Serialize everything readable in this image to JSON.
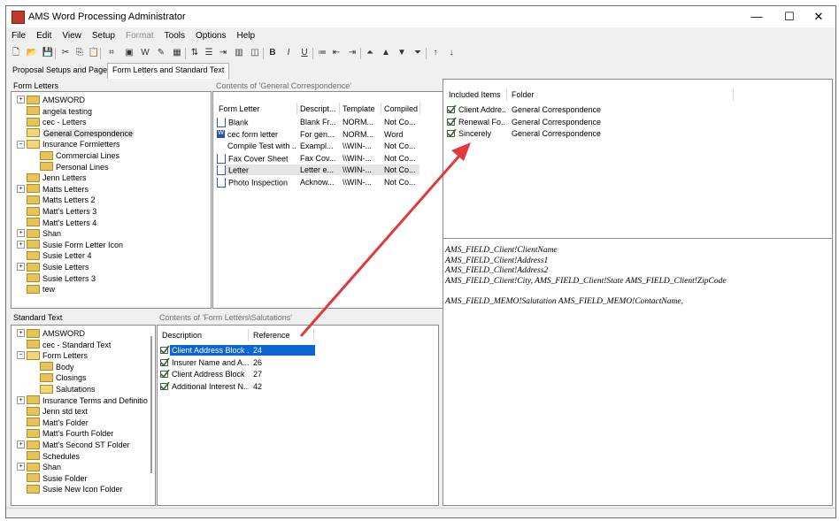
{
  "window": {
    "title": "AMS Word Processing Administrator",
    "controls": {
      "minimize": "—",
      "maximize": "☐",
      "close": "✕"
    }
  },
  "menu": [
    "File",
    "Edit",
    "View",
    "Setup",
    "Format",
    "Tools",
    "Options",
    "Help"
  ],
  "menu_disabled": [
    "Format"
  ],
  "toolbar_icons": [
    "new-icon",
    "open-icon",
    "save-icon",
    "cut-icon",
    "copy-icon",
    "paste-icon",
    "field-icon",
    "pdf-icon",
    "word-icon",
    "edit-icon",
    "preview-icon",
    "sort-icon",
    "list-icon",
    "indent-icon",
    "table-icon",
    "properties-icon",
    "bold-icon",
    "italic-icon",
    "underline-icon",
    "bullets-icon",
    "outdent-icon",
    "indent-more-icon",
    "move-top-icon",
    "move-up-icon",
    "move-down-icon",
    "move-bottom-icon",
    "arrow-up-icon",
    "arrow-down-icon"
  ],
  "toolbar_glyphs": {
    "bold": "B",
    "italic": "I",
    "underline": "U"
  },
  "tabs": [
    {
      "label": "Proposal Setups and Pages",
      "active": false
    },
    {
      "label": "Form Letters and Standard Text",
      "active": true
    }
  ],
  "form_letters": {
    "label": "Form Letters",
    "tree": [
      {
        "label": "AMSWORD",
        "level": 0,
        "expander": "+",
        "open": false,
        "selected": false
      },
      {
        "label": "angela testing",
        "level": 0,
        "expander": "",
        "open": false,
        "selected": false
      },
      {
        "label": "cec - Letters",
        "level": 0,
        "expander": "",
        "open": false,
        "selected": false
      },
      {
        "label": "General Correspondence",
        "level": 0,
        "expander": "",
        "open": true,
        "selected": true
      },
      {
        "label": "Insurance Formletters",
        "level": 0,
        "expander": "−",
        "open": true,
        "selected": false
      },
      {
        "label": "Commercial Lines",
        "level": 1,
        "expander": "",
        "open": false,
        "selected": false
      },
      {
        "label": "Personal Lines",
        "level": 1,
        "expander": "",
        "open": false,
        "selected": false
      },
      {
        "label": "Jenn Letters",
        "level": 0,
        "expander": "",
        "open": false,
        "selected": false
      },
      {
        "label": "Matts Letters",
        "level": 0,
        "expander": "+",
        "open": false,
        "selected": false
      },
      {
        "label": "Matts Letters 2",
        "level": 0,
        "expander": "",
        "open": false,
        "selected": false
      },
      {
        "label": "Matt's Letters 3",
        "level": 0,
        "expander": "",
        "open": false,
        "selected": false
      },
      {
        "label": "Matt's Letters 4",
        "level": 0,
        "expander": "",
        "open": false,
        "selected": false
      },
      {
        "label": "Shan",
        "level": 0,
        "expander": "+",
        "open": false,
        "selected": false
      },
      {
        "label": "Susie Form Letter Icon",
        "level": 0,
        "expander": "+",
        "open": false,
        "selected": false
      },
      {
        "label": "Susie Letter 4",
        "level": 0,
        "expander": "",
        "open": false,
        "selected": false
      },
      {
        "label": "Susie Letters",
        "level": 0,
        "expander": "+",
        "open": false,
        "selected": false
      },
      {
        "label": "Susie Letters 3",
        "level": 0,
        "expander": "",
        "open": false,
        "selected": false
      },
      {
        "label": "tew",
        "level": 0,
        "expander": "",
        "open": false,
        "selected": false
      }
    ]
  },
  "contents_letters": {
    "label": "Contents of 'General Correspondence'",
    "columns": [
      "Form Letter",
      "Descript...",
      "Template",
      "Compiled"
    ],
    "rows": [
      {
        "icon": "doc",
        "cells": [
          "Blank",
          "Blank Fr...",
          "NORM...",
          "Not Co..."
        ],
        "selected": false
      },
      {
        "icon": "word",
        "cells": [
          "cec form letter",
          "For gen...",
          "NORM...",
          "Word"
        ],
        "selected": false
      },
      {
        "icon": "none",
        "cells": [
          "Compile Test with ...",
          "Exampl...",
          "\\\\WIN-...",
          "Not Co..."
        ],
        "selected": false
      },
      {
        "icon": "doc",
        "cells": [
          "Fax Cover Sheet",
          "Fax Cov...",
          "\\\\WIN-...",
          "Not Co..."
        ],
        "selected": false
      },
      {
        "icon": "doc",
        "cells": [
          "Letter",
          "Letter e...",
          "\\\\WIN-...",
          "Not Co..."
        ],
        "selected": true
      },
      {
        "icon": "doc",
        "cells": [
          "Photo Inspection",
          "Acknow...",
          "\\\\WIN-...",
          "Not Co..."
        ],
        "selected": false
      }
    ]
  },
  "included": {
    "columns": [
      "Included Items",
      "Folder"
    ],
    "rows": [
      {
        "item": "Client Addre...",
        "folder": "General Correspondence"
      },
      {
        "item": "Renewal Fo...",
        "folder": "General Correspondence"
      },
      {
        "item": "Sincerely",
        "folder": "General Correspondence"
      }
    ]
  },
  "preview_lines": [
    "AMS_FIELD_Client!ClientName",
    "AMS_FIELD_Client!Address1",
    "AMS_FIELD_Client!Address2",
    "AMS_FIELD_Client!City, AMS_FIELD_Client!State  AMS_FIELD_Client!ZipCode",
    "",
    "AMS_FIELD_MEMO!Salutation AMS_FIELD_MEMO!ContactName,"
  ],
  "standard_text": {
    "label": "Standard Text",
    "tree": [
      {
        "label": "AMSWORD",
        "level": 0,
        "expander": "+",
        "open": false
      },
      {
        "label": "cec - Standard Text",
        "level": 0,
        "expander": "",
        "open": false
      },
      {
        "label": "Form Letters",
        "level": 0,
        "expander": "−",
        "open": true
      },
      {
        "label": "Body",
        "level": 1,
        "expander": "",
        "open": false
      },
      {
        "label": "Closings",
        "level": 1,
        "expander": "",
        "open": false
      },
      {
        "label": "Salutations",
        "level": 1,
        "expander": "",
        "open": true
      },
      {
        "label": "Insurance Terms and Definitio",
        "level": 0,
        "expander": "+",
        "open": false
      },
      {
        "label": "Jenn std text",
        "level": 0,
        "expander": "",
        "open": false
      },
      {
        "label": "Matt's Folder",
        "level": 0,
        "expander": "",
        "open": false
      },
      {
        "label": "Matt's Fourth Folder",
        "level": 0,
        "expander": "",
        "open": false
      },
      {
        "label": "Matt's Second ST Folder",
        "level": 0,
        "expander": "+",
        "open": false
      },
      {
        "label": "Schedules",
        "level": 0,
        "expander": "",
        "open": false
      },
      {
        "label": "Shan",
        "level": 0,
        "expander": "+",
        "open": false
      },
      {
        "label": "Susie Folder",
        "level": 0,
        "expander": "",
        "open": false
      },
      {
        "label": "Susie New Icon Folder",
        "level": 0,
        "expander": "",
        "open": false
      }
    ]
  },
  "contents_std": {
    "label": "Contents of 'Form Letters\\Salutations'",
    "columns": [
      "Description",
      "Reference"
    ],
    "rows": [
      {
        "desc": "Client Address Block ...",
        "ref": "24",
        "selected": true
      },
      {
        "desc": "Insurer Name and A...",
        "ref": "26",
        "selected": false
      },
      {
        "desc": "Client Address Block",
        "ref": "27",
        "selected": false
      },
      {
        "desc": "Additional Interest N...",
        "ref": "42",
        "selected": false
      }
    ]
  },
  "colors": {
    "selection_blue": "#0a64d2",
    "annotation_arrow": "#e0393e",
    "folder_yellow": "#e8c35a"
  }
}
